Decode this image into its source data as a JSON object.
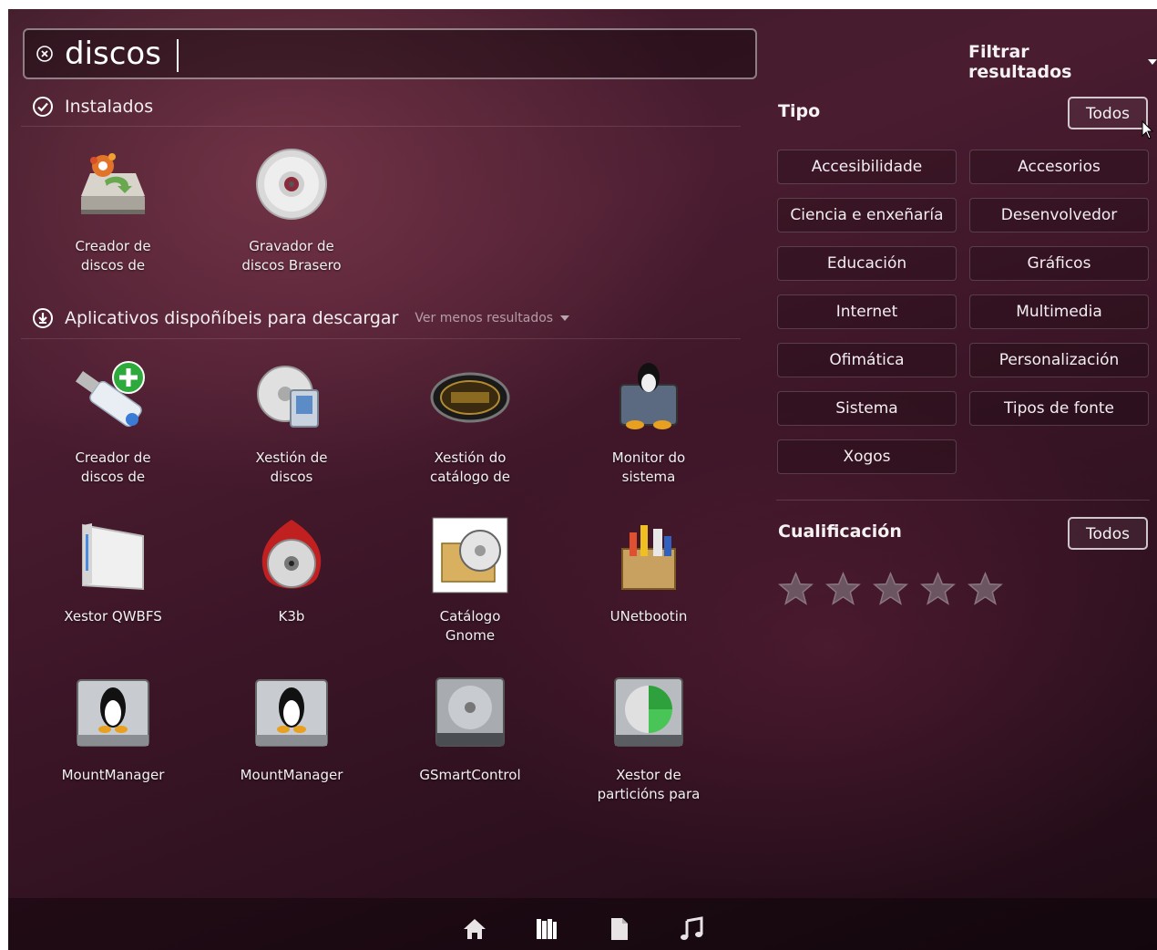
{
  "search": {
    "query": "discos"
  },
  "sections": {
    "installed": {
      "title": "Instalados"
    },
    "available": {
      "title": "Aplicativos dispoñíbeis para descargar",
      "more_label": "Ver menos resultados"
    }
  },
  "installed_apps": [
    {
      "label_1": "Creador de",
      "label_2": "discos de",
      "icon": "usb-creator-icon"
    },
    {
      "label_1": "Gravador de",
      "label_2": "discos Brasero",
      "icon": "brasero-disc-icon"
    }
  ],
  "available_apps": [
    {
      "label_1": "Creador de",
      "label_2": "discos de",
      "icon": "usb-stick-add-icon"
    },
    {
      "label_1": "Xestión de",
      "label_2": "discos",
      "icon": "disk-manager-icon"
    },
    {
      "label_1": "Xestión do",
      "label_2": "catálogo de",
      "icon": "catalog-icon"
    },
    {
      "label_1": "Monitor do",
      "label_2": "sistema",
      "icon": "system-monitor-icon"
    },
    {
      "label_1": "Xestor QWBFS",
      "label_2": "",
      "icon": "wii-console-icon"
    },
    {
      "label_1": "K3b",
      "label_2": "",
      "icon": "k3b-icon"
    },
    {
      "label_1": "Catálogo",
      "label_2": "Gnome",
      "icon": "gnome-catalog-icon"
    },
    {
      "label_1": "UNetbootin",
      "label_2": "",
      "icon": "unetbootin-icon"
    },
    {
      "label_1": "MountManager",
      "label_2": "",
      "icon": "tux-drive-icon"
    },
    {
      "label_1": "MountManager",
      "label_2": "",
      "icon": "tux-drive-icon"
    },
    {
      "label_1": "GSmartControl",
      "label_2": "",
      "icon": "hard-drive-icon"
    },
    {
      "label_1": "Xestor de",
      "label_2": "particións para",
      "icon": "partition-drive-icon"
    }
  ],
  "filter": {
    "title": "Filtrar resultados",
    "type_heading": "Tipo",
    "type_all": "Todos",
    "categories": [
      "Accesibilidade",
      "Accesorios",
      "Ciencia e enxeñaría",
      "Desenvolvedor",
      "Educación",
      "Gráficos",
      "Internet",
      "Multimedia",
      "Ofimática",
      "Personalización",
      "Sistema",
      "Tipos de fonte",
      "Xogos"
    ],
    "rating_heading": "Cualificación",
    "rating_all": "Todos",
    "rating_value": 0,
    "rating_max": 5
  },
  "lenses": [
    "home-icon",
    "applications-icon",
    "files-icon",
    "music-icon"
  ],
  "colors": {
    "accent": "#f5f2f3",
    "background": "#3a1526"
  }
}
